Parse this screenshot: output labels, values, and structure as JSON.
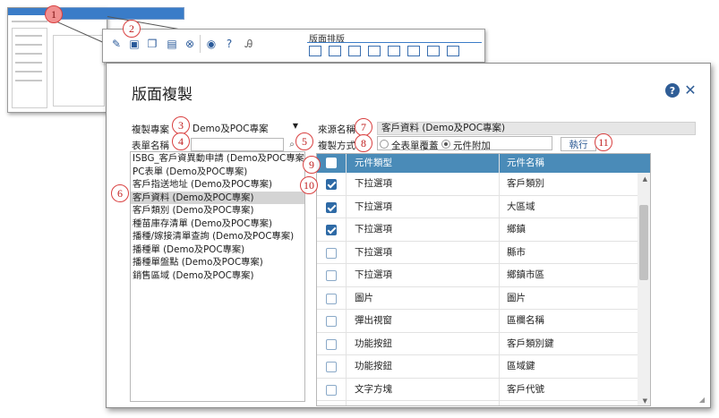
{
  "toolbar": {
    "layout_title": "版面排版"
  },
  "dialog": {
    "title": "版面複製",
    "help_glyph": "?",
    "close_glyph": "✕",
    "project_label": "複製專案",
    "project_value": "Demo及POC專案",
    "form_name_label": "表單名稱",
    "source_label": "來源名稱",
    "source_value": "客戶資料 (Demo及POC專案)",
    "copy_mode_label": "複製方式",
    "copy_mode_options": [
      "全表單覆蓋",
      "元件附加"
    ],
    "copy_mode_selected": "元件附加",
    "execute_label": "執行"
  },
  "form_list": [
    "ISBG_客戶資異動申請 (Demo及POC專案)",
    "PC表單 (Demo及POC專案)",
    "客戶指送地址 (Demo及POC專案)",
    "客戶資料 (Demo及POC專案)",
    "客戶類別 (Demo及POC專案)",
    "種苗庫存清單 (Demo及POC專案)",
    "播種/嫁接清單查詢 (Demo及POC專案)",
    "播種單 (Demo及POC專案)",
    "播種單盤點 (Demo及POC專案)",
    "銷售區域 (Demo及POC專案)"
  ],
  "selected_form": "客戶資料 (Demo及POC專案)",
  "table": {
    "headers": [
      "元件類型",
      "元件名稱"
    ],
    "rows": [
      {
        "type": "下拉選項",
        "name": "客戶類別",
        "checked": true
      },
      {
        "type": "下拉選項",
        "name": "大區域",
        "checked": true
      },
      {
        "type": "下拉選項",
        "name": "鄉鎮",
        "checked": true
      },
      {
        "type": "下拉選項",
        "name": "縣市",
        "checked": false
      },
      {
        "type": "下拉選項",
        "name": "鄉鎮市區",
        "checked": false
      },
      {
        "type": "圖片",
        "name": "圖片",
        "checked": false
      },
      {
        "type": "彈出視窗",
        "name": "區欄名稱",
        "checked": false
      },
      {
        "type": "功能按鈕",
        "name": "客戶類別鍵",
        "checked": false
      },
      {
        "type": "功能按鈕",
        "name": "區域鍵",
        "checked": false
      },
      {
        "type": "文字方塊",
        "name": "客戶代號",
        "checked": false
      }
    ]
  },
  "markers": [
    "1",
    "2",
    "3",
    "4",
    "5",
    "6",
    "7",
    "8",
    "9",
    "10",
    "11"
  ],
  "colors": {
    "accent": "#2f5d96",
    "header_bg": "#4a8bb8",
    "marker": "#d94040"
  }
}
